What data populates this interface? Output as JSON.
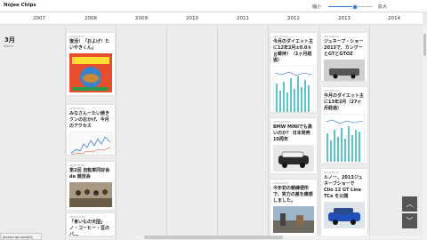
{
  "app": {
    "title": "Nojee Chips"
  },
  "zoom": {
    "shrink_label": "縮小",
    "expand_label": "拡大",
    "level": 0.6
  },
  "years": [
    "2007",
    "2008",
    "2009",
    "2010",
    "2011",
    "2012",
    "2013",
    "2014"
  ],
  "month": {
    "label": "3月",
    "sub": "March"
  },
  "posts": [
    {
      "date": "2007/03/03",
      "title": "復活！「およげ！たいやきくん」",
      "thumb": "taiyaki-record-cover"
    },
    {
      "date": "2007/03/24",
      "title": "みなさんーたい焼きクンのおかげ、今月のアクセス",
      "thumb": "access-chart"
    },
    {
      "date": "2007/03/28",
      "title": "第2回 自転車同好会 de 競技会",
      "thumb": "group-photo"
    },
    {
      "date": "2007/03/29",
      "title": "「食いもの天国」ノ・コーヒー・豆のバ…",
      "thumb": "photo"
    },
    {
      "date": "2012/03/02",
      "title": "今月のダイエット主に12年2月±0.0ｋｇ維持！（1ヶ月経過）",
      "thumb": "weight-chart"
    },
    {
      "date": "2012/03/10",
      "title": "BMW MINIでも高いのか？ 日本発売10周年",
      "thumb": "mini-car"
    },
    {
      "date": "2012/03/18",
      "title": "今年初の朝練便所で、実力の差を痛感しました。",
      "thumb": "street-photo"
    },
    {
      "date": "2013/03/01",
      "title": "ジュネーブ・ショー2013で、カングーとGTとGTOZ",
      "thumb": "car-photo"
    },
    {
      "date": "2013/03/05",
      "title": "今月のダイエット主に13年2月（27ヶ月経過）",
      "thumb": "weight-chart"
    },
    {
      "date": "2013/03/20",
      "title": "ルノー、2013ジュネーブショーで Clio 12 GT Line TCe を公開",
      "thumb": "blue-car"
    }
  ],
  "status": {
    "text": "javascript:void(0);"
  },
  "nav": {
    "up": "︿",
    "down": "﹀"
  }
}
